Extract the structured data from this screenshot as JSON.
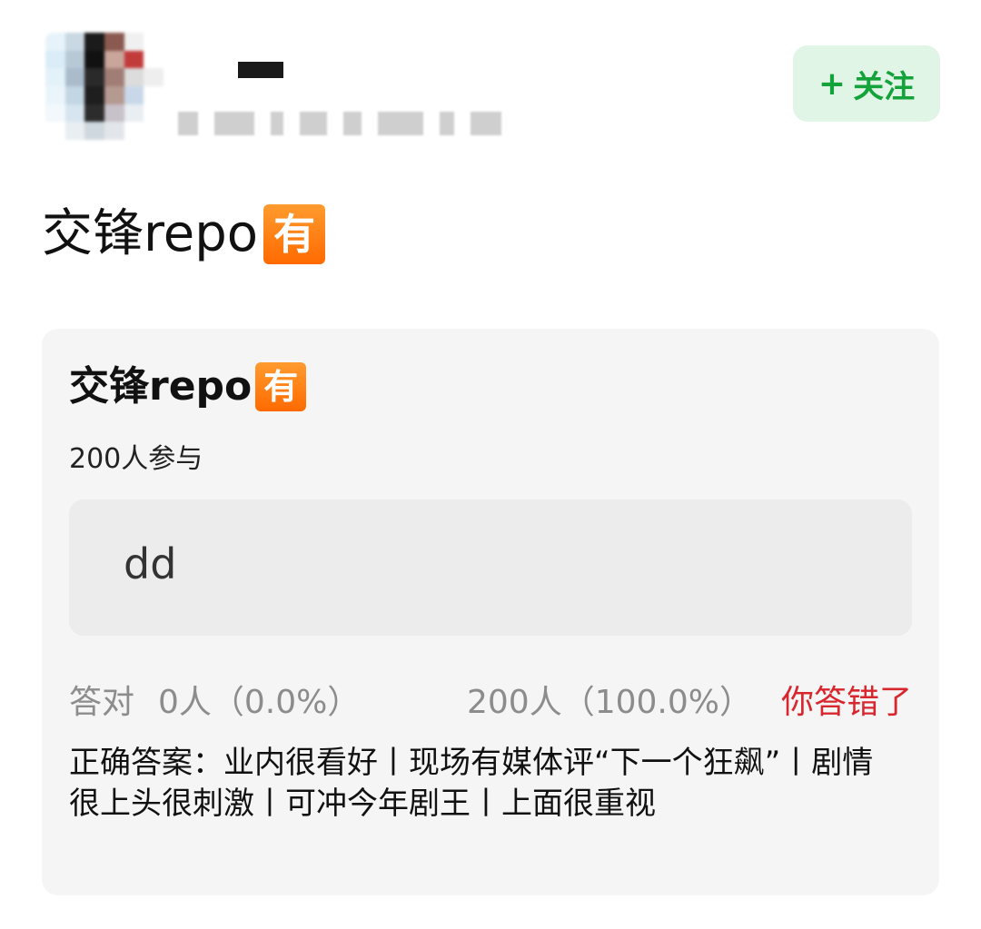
{
  "header": {
    "follow_label": "关注",
    "follow_icon": "plus-icon",
    "accent_color": "#14a33a"
  },
  "post": {
    "title": "交锋repo",
    "emoji": "有"
  },
  "quiz": {
    "title": "交锋repo",
    "emoji": "有",
    "participants": "200人参与",
    "option_label": "dd",
    "correct_label": "答对",
    "correct_value": "0人（0.0%）",
    "wrong_value": "200人（100.0%）",
    "result": "你答错了",
    "result_color": "#d8262e",
    "answer": "正确答案：业内很看好丨现场有媒体评“下一个狂飙”丨剧情很上头很刺激丨可冲今年剧王丨上面很重视"
  }
}
